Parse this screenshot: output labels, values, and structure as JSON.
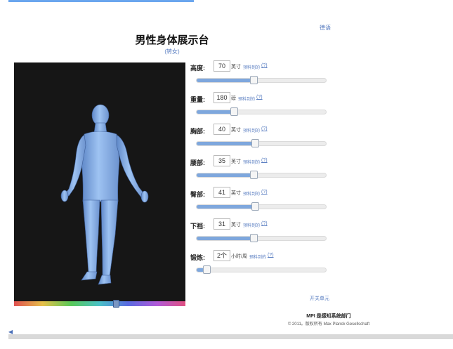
{
  "header": {
    "language_link": "德语",
    "title": "男性身体展示台",
    "switch_gender": "(转女)"
  },
  "colors": {
    "body_fill": "#8fb6ea",
    "slider_fill": "#7ea7dd",
    "link": "#5b7fc2",
    "viewer_bg": "#161616"
  },
  "params": [
    {
      "key": "height",
      "label": "高度:",
      "value": "70",
      "unit": "英寸",
      "predicted": "预料到的",
      "help": "(?)",
      "fraction": 0.44
    },
    {
      "key": "weight",
      "label": "重量:",
      "value": "180",
      "unit": "磅",
      "predicted": "预料到的",
      "help": "(?)",
      "fraction": 0.29
    },
    {
      "key": "chest",
      "label": "胸部:",
      "value": "40",
      "unit": "英寸",
      "predicted": "预料到的",
      "help": "(?)",
      "fraction": 0.45
    },
    {
      "key": "waist",
      "label": "腰部:",
      "value": "35",
      "unit": "英寸",
      "predicted": "预料到的",
      "help": "(?)",
      "fraction": 0.44
    },
    {
      "key": "hips",
      "label": "臀部:",
      "value": "41",
      "unit": "英寸",
      "predicted": "预料到的",
      "help": "(?)",
      "fraction": 0.45
    },
    {
      "key": "inseam",
      "label": "下裆:",
      "value": "31",
      "unit": "英寸",
      "predicted": "预料到的",
      "help": "(?)",
      "fraction": 0.44
    },
    {
      "key": "exercise",
      "label": "锻炼:",
      "value": "2个",
      "unit": "小时/周",
      "predicted": "预料到的",
      "help": "(?)",
      "fraction": 0.08
    }
  ],
  "hue_slider": {
    "fraction": 0.6
  },
  "footer": {
    "toggle_units": "开关单元",
    "org": "MPI 是感知系统部门",
    "copyright": "© 2011。版权所有 Max Planck Gesellschaft"
  }
}
